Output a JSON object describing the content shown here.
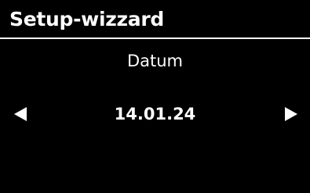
{
  "header": {
    "title": "Setup-wizzard"
  },
  "field": {
    "label": "Datum",
    "value": "14.01.24"
  },
  "controls": {
    "prev_icon": "triangle-left-icon",
    "next_icon": "triangle-right-icon"
  },
  "colors": {
    "background": "#000000",
    "foreground": "#ffffff"
  }
}
